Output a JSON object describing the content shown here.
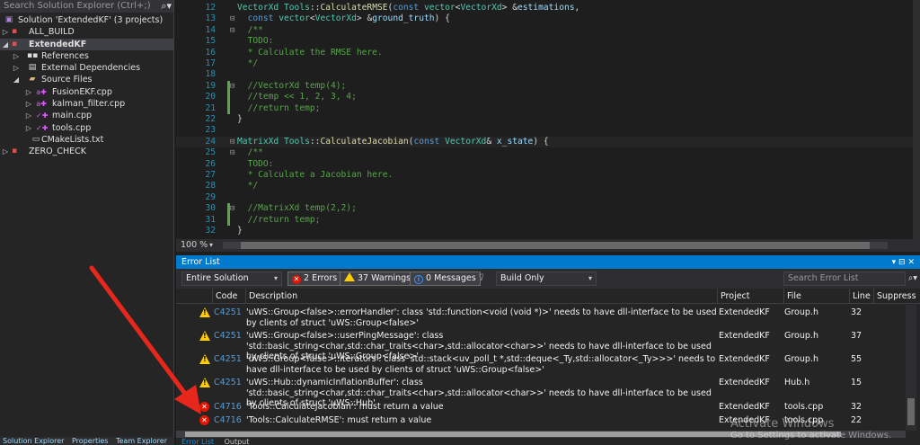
{
  "solution_explorer": {
    "search_placeholder": "Search Solution Explorer (Ctrl+;)",
    "items": [
      {
        "label": "Solution 'ExtendedKF' (3 projects)",
        "icon": "solution-icon"
      },
      {
        "label": "ALL_BUILD",
        "icon": "project-icon"
      },
      {
        "label": "ExtendedKF",
        "icon": "project-icon"
      },
      {
        "label": "References",
        "icon": "references-icon"
      },
      {
        "label": "External Dependencies",
        "icon": "external-deps-icon"
      },
      {
        "label": "Source Files",
        "icon": "folder-icon"
      },
      {
        "label": "FusionEKF.cpp",
        "icon": "cpp-file-icon"
      },
      {
        "label": "kalman_filter.cpp",
        "icon": "cpp-file-icon"
      },
      {
        "label": "main.cpp",
        "icon": "cpp-file-icon"
      },
      {
        "label": "tools.cpp",
        "icon": "cpp-file-icon"
      },
      {
        "label": "CMakeLists.txt",
        "icon": "text-file-icon"
      },
      {
        "label": "ZERO_CHECK",
        "icon": "project-icon"
      }
    ],
    "bottom_tabs": [
      "Solution Explorer",
      "Properties",
      "Team Explorer"
    ]
  },
  "editor": {
    "line_numbers": [
      "12",
      "13",
      "14",
      "15",
      "16",
      "17",
      "18",
      "19",
      "20",
      "21",
      "22",
      "23",
      "24",
      "25",
      "26",
      "27",
      "28",
      "29",
      "30",
      "31",
      "32"
    ],
    "zoom": "100 %"
  },
  "error_list": {
    "title": "Error List",
    "window_controls": "▾ ⊟ ✕",
    "scope": "Entire Solution",
    "errors_label": "2 Errors",
    "warnings_label": "37 Warnings",
    "messages_label": "0 Messages",
    "build_filter": "Build Only",
    "search_placeholder": "Search Error List",
    "columns": {
      "code": "Code",
      "description": "Description",
      "project": "Project",
      "file": "File",
      "line": "Line",
      "suppression": "Suppress"
    },
    "rows": [
      {
        "severity": "warning",
        "code": "C4251",
        "desc": "'uWS::Group<false>::errorHandler': class 'std::function<void (void *)>' needs to have dll-interface to be used by clients of struct 'uWS::Group<false>'",
        "project": "ExtendedKF",
        "file": "Group.h",
        "line": "32"
      },
      {
        "severity": "warning",
        "code": "C4251",
        "desc": "'uWS::Group<false>::userPingMessage': class 'std::basic_string<char,std::char_traits<char>,std::allocator<char>>' needs to have dll-interface to be used by clients of struct 'uWS::Group<false>'",
        "project": "ExtendedKF",
        "file": "Group.h",
        "line": "37"
      },
      {
        "severity": "warning",
        "code": "C4251",
        "desc": "'uWS::Group<false>::iterators': class 'std::stack<uv_poll_t *,std::deque<_Ty,std::allocator<_Ty>>>' needs to have dll-interface to be used by clients of struct 'uWS::Group<false>'",
        "project": "ExtendedKF",
        "file": "Group.h",
        "line": "55"
      },
      {
        "severity": "warning",
        "code": "C4251",
        "desc": "'uWS::Hub::dynamicInflationBuffer': class 'std::basic_string<char,std::char_traits<char>,std::allocator<char>>' needs to have dll-interface to be used by clients of struct 'uWS::Hub'",
        "project": "ExtendedKF",
        "file": "Hub.h",
        "line": "15"
      },
      {
        "severity": "error",
        "code": "C4716",
        "desc": "'Tools::CalculateJacobian': must return a value",
        "project": "ExtendedKF",
        "file": "tools.cpp",
        "line": "32"
      },
      {
        "severity": "error",
        "code": "C4716",
        "desc": "'Tools::CalculateRMSE': must return a value",
        "project": "ExtendedKF",
        "file": "tools.cpp",
        "line": "22"
      }
    ],
    "bottom_tabs": [
      "Error List",
      "Output"
    ]
  },
  "watermark": {
    "title": "Activate Windows",
    "subtitle": "Go to Settings to activate Windows."
  },
  "colors": {
    "accent": "#007acc",
    "error": "#e51400",
    "warning": "#ffcc00",
    "annotation_arrow": "#e8271c"
  }
}
